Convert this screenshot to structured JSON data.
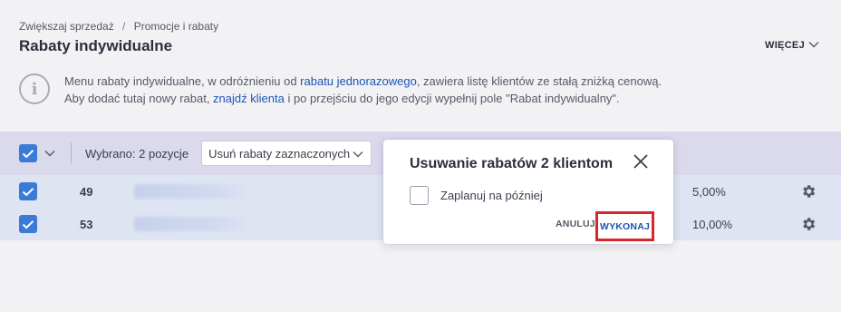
{
  "breadcrumb": {
    "items": [
      "Zwiększaj sprzedaż",
      "Promocje i rabaty"
    ],
    "separator": "/"
  },
  "page_title": "Rabaty indywidualne",
  "header": {
    "more_label": "WIĘCEJ"
  },
  "info": {
    "line1_before": "Menu rabaty indywidualne, w odróżnieniu od ",
    "line1_link": "rabatu jednorazowego",
    "line1_after": ", zawiera listę klientów ze stałą zniżką cenową.",
    "line2_before": "Aby dodać tutaj nowy rabat, ",
    "line2_link": "znajdź klienta",
    "line2_after": " i po przejściu do jego edycji wypełnij pole \"Rabat indywidualny\"."
  },
  "toolbar": {
    "selected_text": "Wybrano: 2 pozycje",
    "action_select_value": "Usuń rabaty zaznaczonych"
  },
  "rows": [
    {
      "id": "49",
      "discount": "5,00%",
      "checked": true
    },
    {
      "id": "53",
      "discount": "10,00%",
      "checked": true
    }
  ],
  "modal": {
    "title": "Usuwanie rabatów 2 klientom",
    "option_label": "Zaplanuj na później",
    "cancel_label": "ANULUJ",
    "execute_label": "WYKONAJ"
  },
  "colors": {
    "accent": "#3b7bd8",
    "link": "#1c55b5",
    "highlight": "#d7262f",
    "toolbar_bg": "#dbd9ec",
    "rows_bg": "#dfe4f2"
  },
  "icons": [
    "chevron-down-icon",
    "info-icon",
    "checkbox-checked-icon",
    "gear-icon",
    "close-icon"
  ]
}
